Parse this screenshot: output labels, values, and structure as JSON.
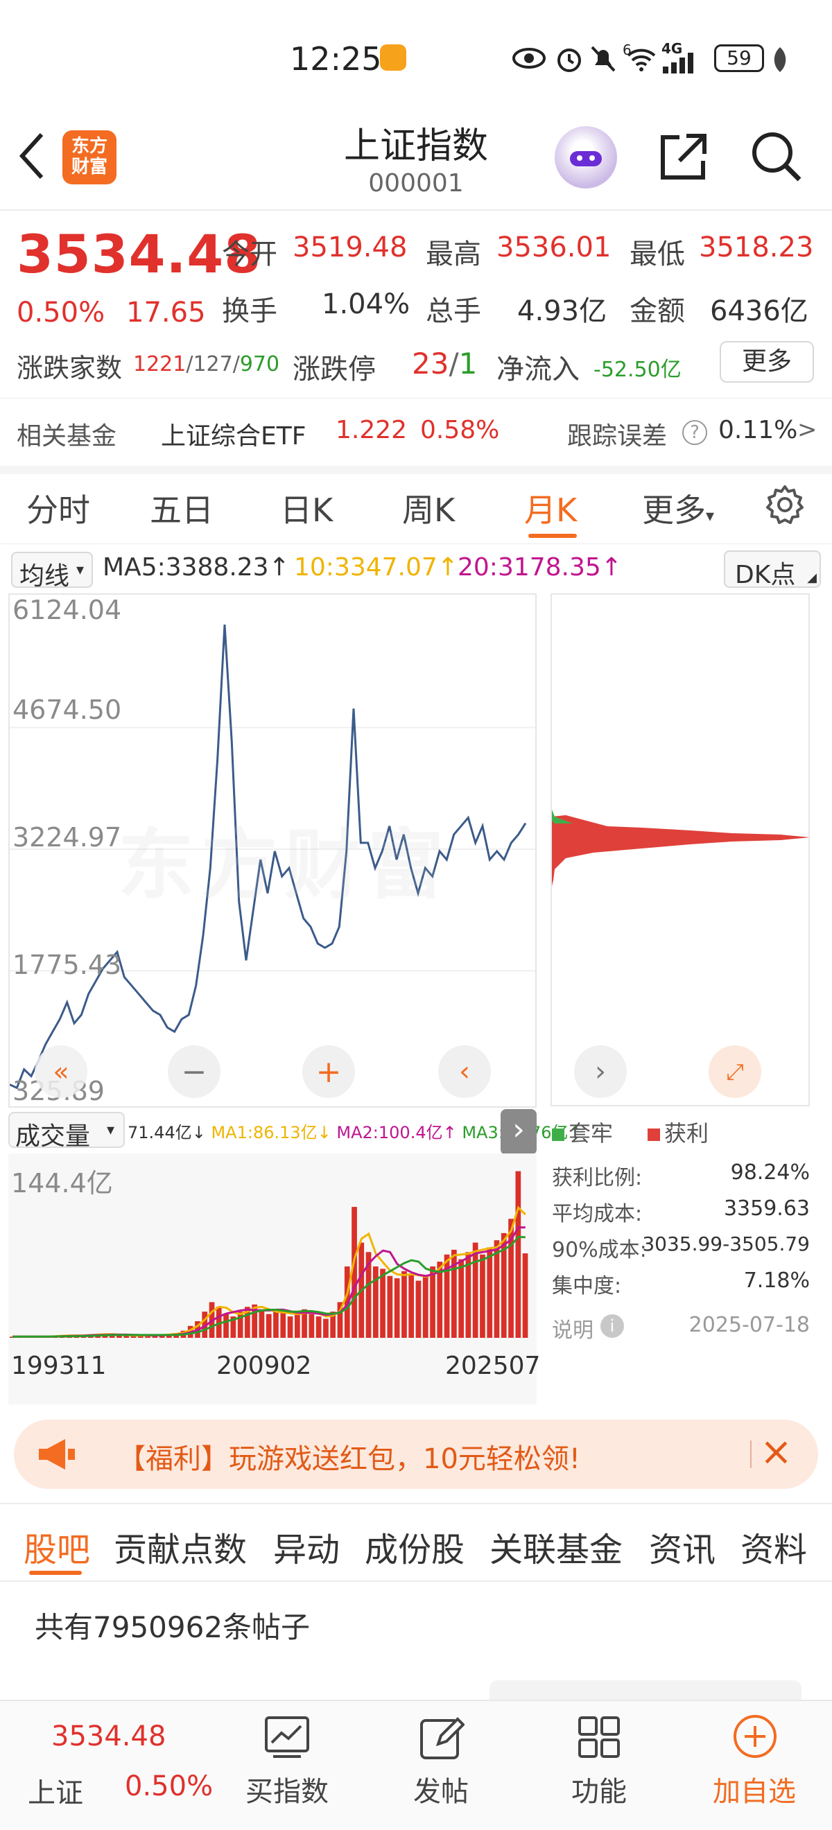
{
  "status_bar": {
    "time": "12:25",
    "battery": "59",
    "network": "4G",
    "wifi_badge": "6"
  },
  "nav": {
    "title": "上证指数",
    "code": "000001",
    "logo_text_1": "东方",
    "logo_text_2": "财富"
  },
  "quote": {
    "price": "3534.48",
    "change_pct": "0.50%",
    "change_abs": "17.65",
    "open_label": "今开",
    "open": "3519.48",
    "high_label": "最高",
    "high": "3536.01",
    "low_label": "最低",
    "low": "3518.23",
    "turnover_label": "换手",
    "turnover": "1.04%",
    "volume_label": "总手",
    "volume": "4.93亿",
    "amount_label": "金额",
    "amount": "6436亿",
    "updown_label": "涨跌家数",
    "up_count": "1221",
    "flat_count": "127",
    "down_count": "970",
    "limit_label": "涨跌停",
    "limit_up": "23",
    "limit_down": "1",
    "inflow_label": "净流入",
    "inflow": "-52.50亿",
    "more_button": "更多"
  },
  "fund": {
    "label": "相关基金",
    "name": "上证综合ETF",
    "price": "1.222",
    "change": "0.58%",
    "tracking_label": "跟踪误差",
    "tracking_value": "0.11%",
    "arrow": ">"
  },
  "tabs": [
    "分时",
    "五日",
    "日K",
    "周K",
    "月K",
    "更多"
  ],
  "active_tab": "月K",
  "ma": {
    "selector": "均线",
    "ma5": "MA5:3388.23",
    "ma10": "10:3347.07",
    "ma20": "20:3178.35",
    "dk_button": "DK点",
    "colors": {
      "ma5": "#333333",
      "ma10": "#f0b400",
      "ma20": "#c0158f"
    }
  },
  "chart_data": [
    {
      "type": "line",
      "y_ticks": [
        "6124.04",
        "4674.50",
        "3224.97",
        "1775.43",
        "325.89"
      ],
      "ylim": [
        325.89,
        6124.04
      ],
      "x_ticks": [
        "199311",
        "200902",
        "202507"
      ],
      "series": [
        {
          "color": "#3b5b8a",
          "values": [
            420,
            380,
            600,
            520,
            700,
            900,
            1050,
            1200,
            1400,
            1150,
            1250,
            1500,
            1650,
            1800,
            1900,
            2000,
            1700,
            1600,
            1500,
            1400,
            1300,
            1250,
            1100,
            1050,
            1200,
            1250,
            1600,
            2200,
            3000,
            4300,
            5900,
            4500,
            2600,
            1900,
            2500,
            3100,
            2700,
            3200,
            2900,
            3000,
            2700,
            2400,
            2300,
            2100,
            2050,
            2100,
            2300,
            3200,
            4900,
            3300,
            3300,
            3000,
            3200,
            3500,
            3100,
            3400,
            3000,
            2700,
            3000,
            2900,
            3200,
            3100,
            3400,
            3500,
            3600,
            3300,
            3500,
            3100,
            3200,
            3100,
            3300,
            3400,
            3534
          ]
        }
      ]
    },
    {
      "type": "bar",
      "label": "成交量",
      "y_ticks": [
        "144.4亿"
      ],
      "ylim": [
        0,
        144.4
      ],
      "x_ticks": [
        "199311",
        "200902",
        "202507"
      ],
      "legend": {
        "vol": "71.44亿",
        "ma1": "MA1:86.13亿",
        "ma2": "MA2:100.4亿",
        "ma3": "MA3:83.76亿"
      },
      "series": [
        {
          "color": "#d93028",
          "values": [
            1,
            1,
            1,
            1,
            1,
            1,
            2,
            2,
            2,
            2,
            2,
            3,
            3,
            3,
            3,
            2,
            2,
            2,
            2,
            2,
            2,
            3,
            3,
            4,
            6,
            10,
            14,
            22,
            30,
            26,
            20,
            18,
            22,
            26,
            28,
            24,
            20,
            22,
            22,
            18,
            20,
            24,
            20,
            18,
            16,
            22,
            30,
            60,
            110,
            80,
            72,
            60,
            58,
            52,
            50,
            56,
            54,
            48,
            52,
            60,
            64,
            70,
            74,
            66,
            72,
            80,
            70,
            76,
            82,
            88,
            100,
            140,
            71
          ]
        }
      ]
    }
  ],
  "chip_panel": {
    "legend_trapped": "套牢",
    "legend_profit": "获利",
    "profit_ratio_label": "获利比例:",
    "profit_ratio": "98.24%",
    "avg_cost_label": "平均成本:",
    "avg_cost": "3359.63",
    "cost90_label": "90%成本:",
    "cost90": "3035.99-3505.79",
    "concentration_label": "集中度:",
    "concentration": "7.18%",
    "note_label": "说明",
    "date": "2025-07-18"
  },
  "volume_selector": "成交量",
  "banner": {
    "text": "【福利】玩游戏送红包，10元轻松领!"
  },
  "sub_tabs": [
    "股吧",
    "贡献点数",
    "异动",
    "成份股",
    "关联基金",
    "资讯",
    "资料"
  ],
  "active_sub_tab": "股吧",
  "post_count": "共有7950962条帖子",
  "bottom_nav": {
    "index_price": "3534.48",
    "index_name": "上证",
    "index_change": "0.50%",
    "items": [
      "买指数",
      "发帖",
      "功能",
      "加自选"
    ]
  },
  "watermark": "东方财富"
}
